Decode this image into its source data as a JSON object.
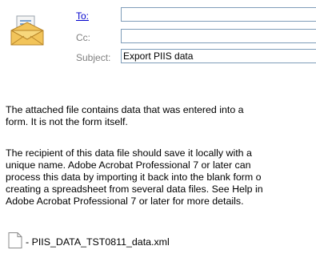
{
  "header": {
    "to_label": "To:",
    "to_value": "",
    "cc_label": "Cc:",
    "cc_value": "",
    "subject_label": "Subject:",
    "subject_value": "Export PIIS data"
  },
  "message": {
    "paragraph1": "The attached file contains data that was entered into a\nform. It is not the form itself.",
    "paragraph2": "The recipient of this data file should save it locally with a\nunique name. Adobe Acrobat Professional 7 or later can\nprocess this data by importing it back into the blank form o\ncreating a spreadsheet from several data files. See Help in\nAdobe Acrobat Professional 7 or later for more details."
  },
  "attachment": {
    "label": "- PIIS_DATA_TST0811_data.xml",
    "icon": "file-icon"
  },
  "icons": {
    "envelope": "envelope-icon"
  }
}
